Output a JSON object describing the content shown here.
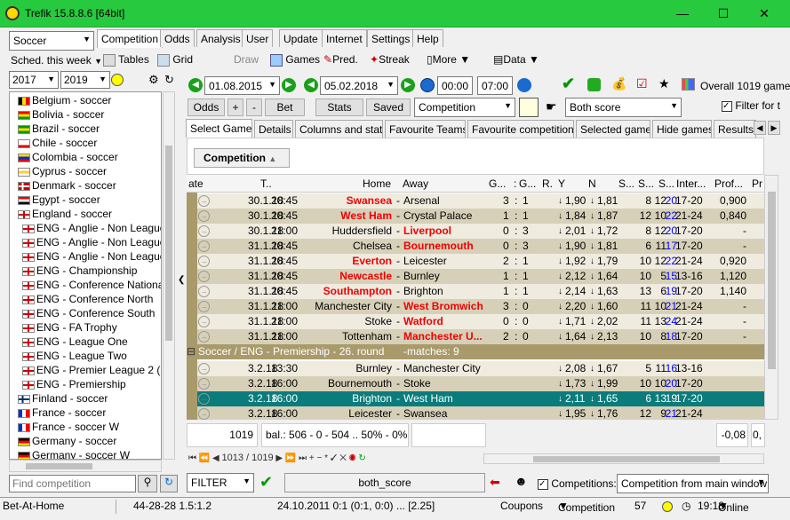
{
  "title": "Trefik 15.8.8.6 [64bit]",
  "sport": "Soccer",
  "sched": "Sched. this week",
  "year_from": "2017",
  "year_to": "2019",
  "main_tabs": [
    "Competition",
    "Odds",
    "Analysis",
    "User",
    "Update",
    "Internet",
    "Settings",
    "Help"
  ],
  "toolbar": {
    "tables": "Tables",
    "grid": "Grid",
    "draw": "Draw",
    "games": "Games",
    "pred": "Pred.",
    "streak": "Streak",
    "more": "More",
    "data": "Data"
  },
  "date_from": "01.08.2015",
  "date_to": "05.02.2018",
  "time_from": "00:00",
  "time_to": "07:00",
  "overall": "Overall 1019 game",
  "btns": {
    "odds": "Odds",
    "plus": "+",
    "minus": "-",
    "bet": "Bet",
    "stats": "Stats",
    "saved": "Saved"
  },
  "comp_combo": "Competition",
  "score_combo": "Both score",
  "filter_label": "Filter for t",
  "sub_tabs": [
    "Select Games",
    "Details",
    "Columns and stats",
    "Favourite Teams",
    "Favourite competitions",
    "Selected games",
    "Hide games",
    "Results o"
  ],
  "group_btn": "Competition",
  "columns": [
    "ate",
    "T..",
    "Home",
    "Away",
    "G...",
    ":",
    "G...",
    "R.",
    "Y",
    "N",
    "S...",
    "S...",
    "S...",
    "Inter...",
    "Prof...",
    "Pr"
  ],
  "rows": [
    {
      "d": "30.1.18",
      "t": "20:45",
      "h": "Swansea",
      "a": "Arsenal",
      "g1": "3",
      "g2": "1",
      "y": "1,90",
      "n": "1,81",
      "s1": "8",
      "s2": "12",
      "s3": "20",
      "i": "17-20",
      "p": "0,900",
      "hr": true,
      "ar": false
    },
    {
      "d": "30.1.18",
      "t": "20:45",
      "h": "West Ham",
      "a": "Crystal Palace",
      "g1": "1",
      "g2": "1",
      "y": "1,84",
      "n": "1,87",
      "s1": "12",
      "s2": "10",
      "s3": "22",
      "i": "21-24",
      "p": "0,840",
      "hr": true,
      "ar": false
    },
    {
      "d": "30.1.18",
      "t": "21:00",
      "h": "Huddersfield",
      "a": "Liverpool",
      "g1": "0",
      "g2": "3",
      "y": "2,01",
      "n": "1,72",
      "s1": "8",
      "s2": "12",
      "s3": "20",
      "i": "17-20",
      "p": "-",
      "hr": false,
      "ar": true
    },
    {
      "d": "31.1.18",
      "t": "20:45",
      "h": "Chelsea",
      "a": "Bournemouth",
      "g1": "0",
      "g2": "3",
      "y": "1,90",
      "n": "1,81",
      "s1": "6",
      "s2": "11",
      "s3": "17",
      "i": "17-20",
      "p": "-",
      "hr": false,
      "ar": true
    },
    {
      "d": "31.1.18",
      "t": "20:45",
      "h": "Everton",
      "a": "Leicester",
      "g1": "2",
      "g2": "1",
      "y": "1,92",
      "n": "1,79",
      "s1": "10",
      "s2": "12",
      "s3": "22",
      "i": "21-24",
      "p": "0,920",
      "hr": true,
      "ar": false
    },
    {
      "d": "31.1.18",
      "t": "20:45",
      "h": "Newcastle",
      "a": "Burnley",
      "g1": "1",
      "g2": "1",
      "y": "2,12",
      "n": "1,64",
      "s1": "10",
      "s2": "5",
      "s3": "15",
      "i": "13-16",
      "p": "1,120",
      "hr": true,
      "ar": false
    },
    {
      "d": "31.1.18",
      "t": "20:45",
      "h": "Southampton",
      "a": "Brighton",
      "g1": "1",
      "g2": "1",
      "y": "2,14",
      "n": "1,63",
      "s1": "13",
      "s2": "6",
      "s3": "19",
      "i": "17-20",
      "p": "1,140",
      "hr": true,
      "ar": false
    },
    {
      "d": "31.1.18",
      "t": "21:00",
      "h": "Manchester City",
      "a": "West Bromwich",
      "g1": "3",
      "g2": "0",
      "y": "2,20",
      "n": "1,60",
      "s1": "11",
      "s2": "10",
      "s3": "21",
      "i": "21-24",
      "p": "-",
      "hr": false,
      "ar": true
    },
    {
      "d": "31.1.18",
      "t": "21:00",
      "h": "Stoke",
      "a": "Watford",
      "g1": "0",
      "g2": "0",
      "y": "1,71",
      "n": "2,02",
      "s1": "11",
      "s2": "13",
      "s3": "24",
      "i": "21-24",
      "p": "-",
      "hr": false,
      "ar": true
    },
    {
      "d": "31.1.18",
      "t": "21:00",
      "h": "Tottenham",
      "a": "Manchester U...",
      "g1": "2",
      "g2": "0",
      "y": "1,64",
      "n": "2,13",
      "s1": "10",
      "s2": "8",
      "s3": "18",
      "i": "17-20",
      "p": "-",
      "hr": false,
      "ar": true
    }
  ],
  "group_row": "Soccer / ENG - Premiership - 26. round",
  "group_matches": "-matches: 9",
  "rows2": [
    {
      "d": "3.2.18",
      "t": "13:30",
      "h": "Burnley",
      "a": "Manchester City",
      "y": "2,08",
      "n": "1,67",
      "s1": "5",
      "s2": "11",
      "s3": "16",
      "i": "13-16"
    },
    {
      "d": "3.2.18",
      "t": "16:00",
      "h": "Bournemouth",
      "a": "Stoke",
      "y": "1,73",
      "n": "1,99",
      "s1": "10",
      "s2": "10",
      "s3": "20",
      "i": "17-20"
    },
    {
      "d": "3.2.18",
      "t": "16:00",
      "h": "Brighton",
      "a": "West Ham",
      "y": "2,11",
      "n": "1,65",
      "s1": "6",
      "s2": "13",
      "s3": "19",
      "i": "17-20"
    },
    {
      "d": "3.2.18",
      "t": "16:00",
      "h": "Leicester",
      "a": "Swansea",
      "y": "1,95",
      "n": "1,76",
      "s1": "12",
      "s2": "9",
      "s3": "21",
      "i": "21-24"
    }
  ],
  "summary": {
    "count": "1019",
    "bal": "bal.: 506 - 0 - 504 .. 50% - 0% - 50",
    "p1": "-0,08",
    "p2": "0,"
  },
  "nav": "1013 / 1019",
  "filter": "FILTER",
  "filter_val": "both_score",
  "competitions_label": "Competitions:",
  "comp_from": "Competition from main window",
  "find_placeholder": "Find competition",
  "tree": [
    "Belgium - soccer",
    "Bolivia - soccer",
    "Brazil - soccer",
    "Chile - soccer",
    "Colombia - soccer",
    "Cyprus - soccer",
    "Denmark - soccer",
    "Egypt - soccer",
    "England - soccer",
    "ENG - Anglie - Non League P",
    "ENG - Anglie - Non League P",
    "ENG - Anglie - Non League P",
    "ENG - Championship",
    "ENG - Conference National",
    "ENG - Conference North",
    "ENG - Conference South",
    "ENG - FA Trophy",
    "ENG - League One",
    "ENG - League Two",
    "ENG - Premier League 2 (Div",
    "ENG - Premiership",
    "Finland - soccer",
    "France - soccer",
    "France - soccer W",
    "Germany - soccer",
    "Germany - soccer W"
  ],
  "status": {
    "s1": "Bet-At-Home",
    "s2": "44-28-28  1.5:1.2",
    "s3": "24.10.2011 0:1 (0:1, 0:0) ... [2.25]",
    "s4": "Coupons",
    "s5": "Competition",
    "s6": "57",
    "s7": "19:18",
    "s8": "Online"
  }
}
